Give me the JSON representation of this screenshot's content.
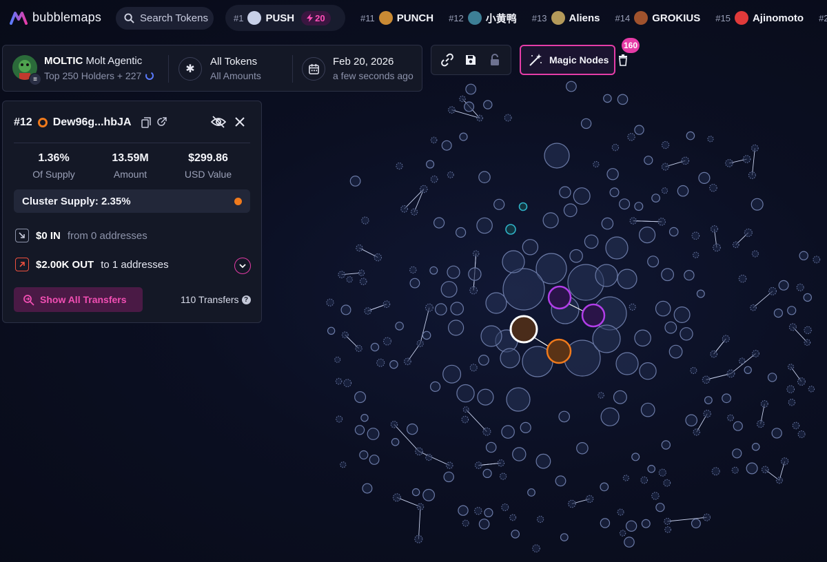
{
  "app": {
    "name": "bubblemaps",
    "search_placeholder": "Search Tokens"
  },
  "ticker": {
    "first": {
      "rank": "#1",
      "name": "PUSH",
      "boost": "20"
    },
    "items": [
      {
        "rank": "#11",
        "name": "PUNCH",
        "icon_color": "#c98a34"
      },
      {
        "rank": "#12",
        "name": "小黄鸭",
        "icon_color": "#3d7f96"
      },
      {
        "rank": "#13",
        "name": "Aliens",
        "icon_color": "#b49a5a"
      },
      {
        "rank": "#14",
        "name": "GROKIUS",
        "icon_color": "#a0522d"
      },
      {
        "rank": "#15",
        "name": "Ajinomoto",
        "icon_color": "#e03a3a"
      },
      {
        "rank": "#2",
        "name": "",
        "icon_color": "#444"
      }
    ]
  },
  "token": {
    "symbol": "MOLTIC",
    "name": "Molt Agentic",
    "holders_label": "Top 250 Holders + 227"
  },
  "filters": {
    "tokens_title": "All Tokens",
    "tokens_sub": "All Amounts",
    "date_title": "Feb 20, 2026",
    "date_sub": "a few seconds ago"
  },
  "toolbar": {
    "magic_label": "Magic Nodes",
    "magic_count": "160"
  },
  "panel": {
    "rank": "#12",
    "address": "Dew96g...hbJA",
    "stats": [
      {
        "value": "1.36%",
        "label": "Of Supply"
      },
      {
        "value": "13.59M",
        "label": "Amount"
      },
      {
        "value": "$299.86",
        "label": "USD Value"
      }
    ],
    "cluster_label": "Cluster Supply: 2.35%",
    "in_amount": "$0 IN",
    "in_detail": "from 0 addresses",
    "out_amount": "$2.00K OUT",
    "out_detail": "to 1 addresses",
    "show_label": "Show All Transfers",
    "transfers_label": "110 Transfers"
  },
  "colors": {
    "accent_pink": "#e53ba6",
    "orange": "#f07a1c",
    "purple": "#b13ee8",
    "cyan": "#2fb3c8",
    "node_stroke": "#6b7aa6"
  }
}
